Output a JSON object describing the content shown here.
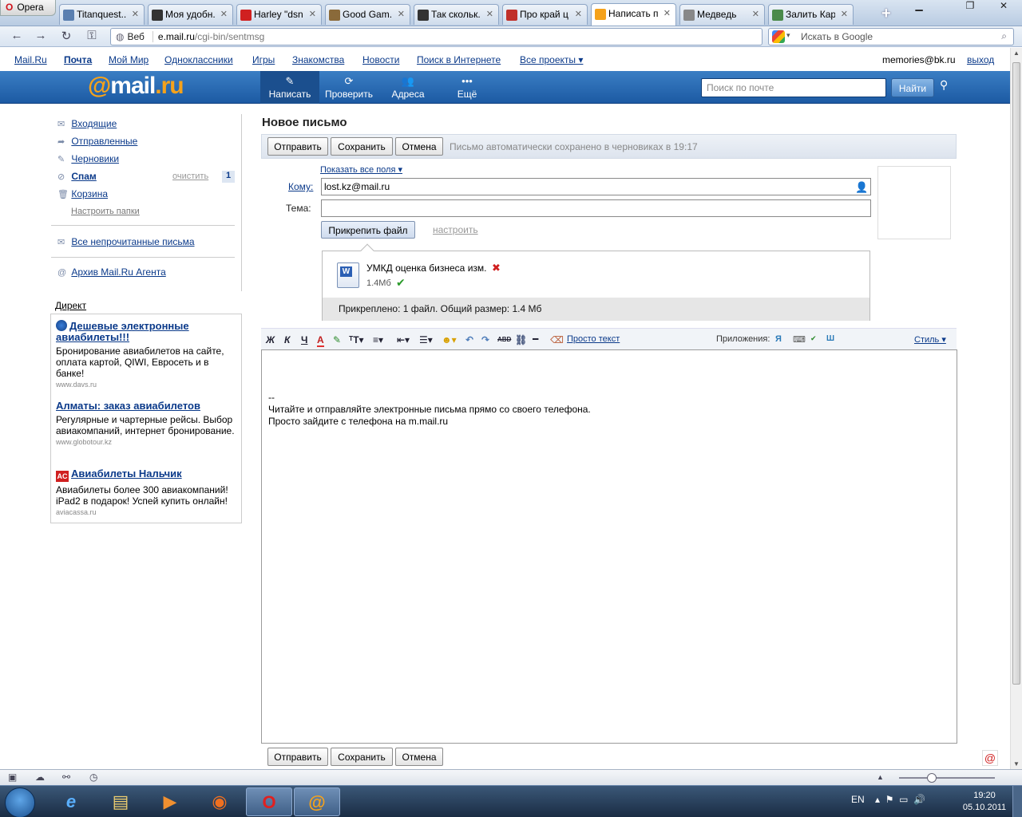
{
  "browser": {
    "menu_label": "Opera",
    "tabs": [
      {
        "title": "Titanquest...",
        "icon": "#5a7fb0",
        "active": false
      },
      {
        "title": "Моя удобн...",
        "icon": "#333",
        "active": false
      },
      {
        "title": "Harley \"dsn...",
        "icon": "#d02020",
        "active": false
      },
      {
        "title": "Good Gam...",
        "icon": "#8a6a3a",
        "active": false
      },
      {
        "title": "Так скольк...",
        "icon": "#333",
        "active": false
      },
      {
        "title": "Про край ц...",
        "icon": "#c0302a",
        "active": false
      },
      {
        "title": "Написать п...",
        "icon": "#f5a21b",
        "active": true
      },
      {
        "title": "Медведь",
        "icon": "#888",
        "active": false
      },
      {
        "title": "Залить Кар...",
        "icon": "#4a8a4a",
        "active": false
      }
    ],
    "url_label": "Веб",
    "url_host": "e.mail.ru",
    "url_path": "/cgi-bin/sentmsg",
    "search_placeholder": "Искать в Google"
  },
  "portal": {
    "links": [
      "Mail.Ru",
      "Почта",
      "Мой Мир",
      "Одноклассники",
      "Игры",
      "Знакомства",
      "Новости",
      "Поиск в Интернете",
      "Все проекты ▾"
    ],
    "user_email": "memories@bk.ru",
    "logout": "выход"
  },
  "header": {
    "logo_at": "@",
    "logo_text": "mail",
    "logo_ru": ".ru",
    "buttons": [
      {
        "label": "Написать",
        "icon": "✎"
      },
      {
        "label": "Проверить",
        "icon": "⟳"
      },
      {
        "label": "Адреса",
        "icon": "👥"
      },
      {
        "label": "Ещё",
        "icon": "•••"
      }
    ],
    "search_placeholder": "Поиск по почте",
    "search_button": "Найти"
  },
  "sidebar": {
    "folders": [
      {
        "label": "Входящие",
        "icon": "✉",
        "bold": false
      },
      {
        "label": "Отправленные",
        "icon": "➦",
        "bold": false
      },
      {
        "label": "Черновики",
        "icon": "✎",
        "bold": false
      },
      {
        "label": "Спам",
        "icon": "⊘",
        "bold": true
      },
      {
        "label": "Корзина",
        "icon": "🗑",
        "bold": false
      }
    ],
    "spam_clear": "очистить",
    "spam_count": "1",
    "setup_folders": "Настроить папки",
    "unread": "Все непрочитанные письма",
    "archive": "Архив Mail.Ru Агента"
  },
  "direct": {
    "title": "Директ",
    "ads": [
      {
        "title": "Дешевые электронные авиабилеты!!!",
        "body": "Бронирование авиабилетов на сайте, оплата картой, QIWI, Евросеть и в банке!",
        "url": "www.davs.ru"
      },
      {
        "title": "Алматы: заказ авиабилетов",
        "body": "Регулярные и чартерные рейсы. Выбор авиакомпаний, интернет бронирование.",
        "url": "www.globotour.kz"
      },
      {
        "title": "Авиабилеты Нальчик",
        "body": "Авиабилеты более 300 авиакомпаний! iPad2 в подарок! Успей купить онлайн!",
        "url": "aviacassa.ru"
      }
    ]
  },
  "compose": {
    "title": "Новое письмо",
    "send": "Отправить",
    "save": "Сохранить",
    "cancel": "Отмена",
    "autosave_prefix": "Письмо автоматически сохранено в",
    "autosave_link": "черновиках",
    "autosave_suffix": "в 19:17",
    "show_fields": "Показать все поля ▾",
    "to_label": "Кому:",
    "to_value": "lost.kz@mail.ru",
    "subject_label": "Тема:",
    "subject_value": "",
    "attach_button": "Прикрепить файл",
    "setup_link": "настроить",
    "file_name": "УМКД оценка бизнеса изм.",
    "file_size": "1.4Мб",
    "attach_summary": "Прикреплено: 1 файл. Общий размер: 1.4 Мб",
    "plain_text": "Просто текст",
    "apps_label": "Приложения:",
    "style_link": "Стиль ▾",
    "body_lines": [
      "--",
      "Читайте и отправляйте электронные письма прямо со своего телефона.",
      "Просто зайдите с телефона на m.mail.ru"
    ]
  },
  "taskbar": {
    "lang": "EN",
    "time": "19:20",
    "date": "05.10.2011"
  }
}
